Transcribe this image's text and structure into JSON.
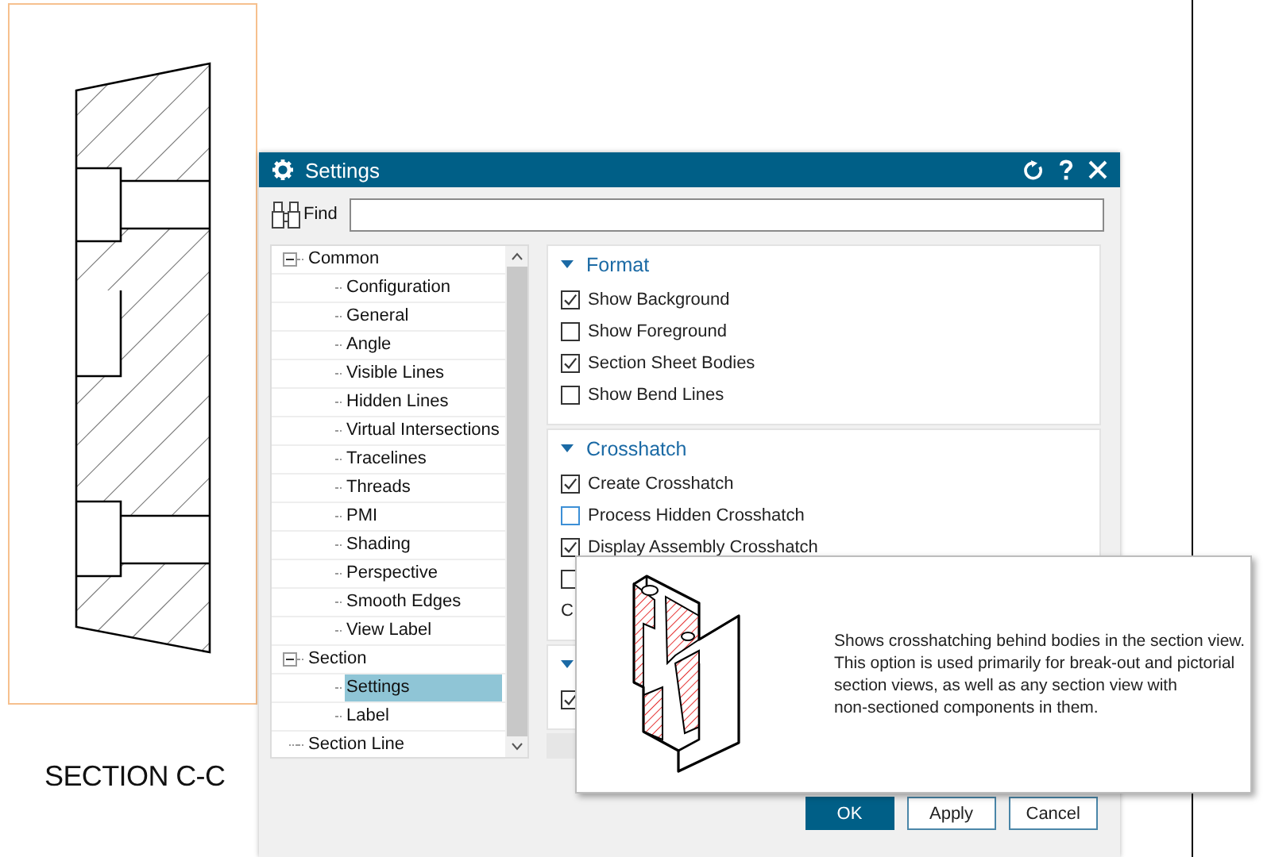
{
  "drawing_view": {
    "label": "SECTION C-C"
  },
  "dialog": {
    "title": "Settings",
    "find": {
      "label": "Find"
    },
    "tree": [
      {
        "label": "Common",
        "expanded": true,
        "selected": false,
        "children": [
          {
            "label": "Configuration",
            "selected": false
          },
          {
            "label": "General",
            "selected": false
          },
          {
            "label": "Angle",
            "selected": false
          },
          {
            "label": "Visible Lines",
            "selected": false
          },
          {
            "label": "Hidden Lines",
            "selected": false
          },
          {
            "label": "Virtual Intersections",
            "selected": false
          },
          {
            "label": "Tracelines",
            "selected": false
          },
          {
            "label": "Threads",
            "selected": false
          },
          {
            "label": "PMI",
            "selected": false
          },
          {
            "label": "Shading",
            "selected": false
          },
          {
            "label": "Perspective",
            "selected": false
          },
          {
            "label": "Smooth Edges",
            "selected": false
          },
          {
            "label": "View Label",
            "selected": false
          }
        ]
      },
      {
        "label": "Section",
        "expanded": true,
        "selected": false,
        "children": [
          {
            "label": "Settings",
            "selected": true
          },
          {
            "label": "Label",
            "selected": false
          }
        ]
      },
      {
        "label": "Section Line",
        "selected": false
      }
    ],
    "sections": [
      {
        "title": "Format",
        "expanded": true,
        "items": [
          {
            "kind": "checkbox",
            "label": "Show Background",
            "checked": true,
            "focused": false
          },
          {
            "kind": "checkbox",
            "label": "Show Foreground",
            "checked": false,
            "focused": false
          },
          {
            "kind": "checkbox",
            "label": "Section Sheet Bodies",
            "checked": true,
            "focused": false
          },
          {
            "kind": "checkbox",
            "label": "Show Bend Lines",
            "checked": false,
            "focused": false
          }
        ]
      },
      {
        "title": "Crosshatch",
        "expanded": true,
        "items": [
          {
            "kind": "checkbox",
            "label": "Create Crosshatch",
            "checked": true,
            "focused": false
          },
          {
            "kind": "checkbox",
            "label": "Process Hidden Crosshatch",
            "checked": false,
            "focused": true
          },
          {
            "kind": "checkbox",
            "label": "Display Assembly Crosshatch",
            "checked": true,
            "focused": false
          },
          {
            "kind": "checkbox",
            "checked": false,
            "focused": false
          },
          {
            "kind": "text",
            "label": "C"
          }
        ]
      },
      {
        "expanded": true,
        "items": [
          {
            "kind": "checkbox",
            "checked": true,
            "focused": false
          }
        ]
      }
    ],
    "buttons": [
      {
        "label": "OK",
        "default": true
      },
      {
        "label": "Apply",
        "default": false
      },
      {
        "label": "Cancel",
        "default": false
      }
    ]
  },
  "tooltip": {
    "lines": [
      "Shows crosshatching behind bodies in the section view.",
      "This option is used primarily for break-out and pictorial",
      "section views, as well as any section view with",
      "non-sectioned components in them."
    ]
  }
}
